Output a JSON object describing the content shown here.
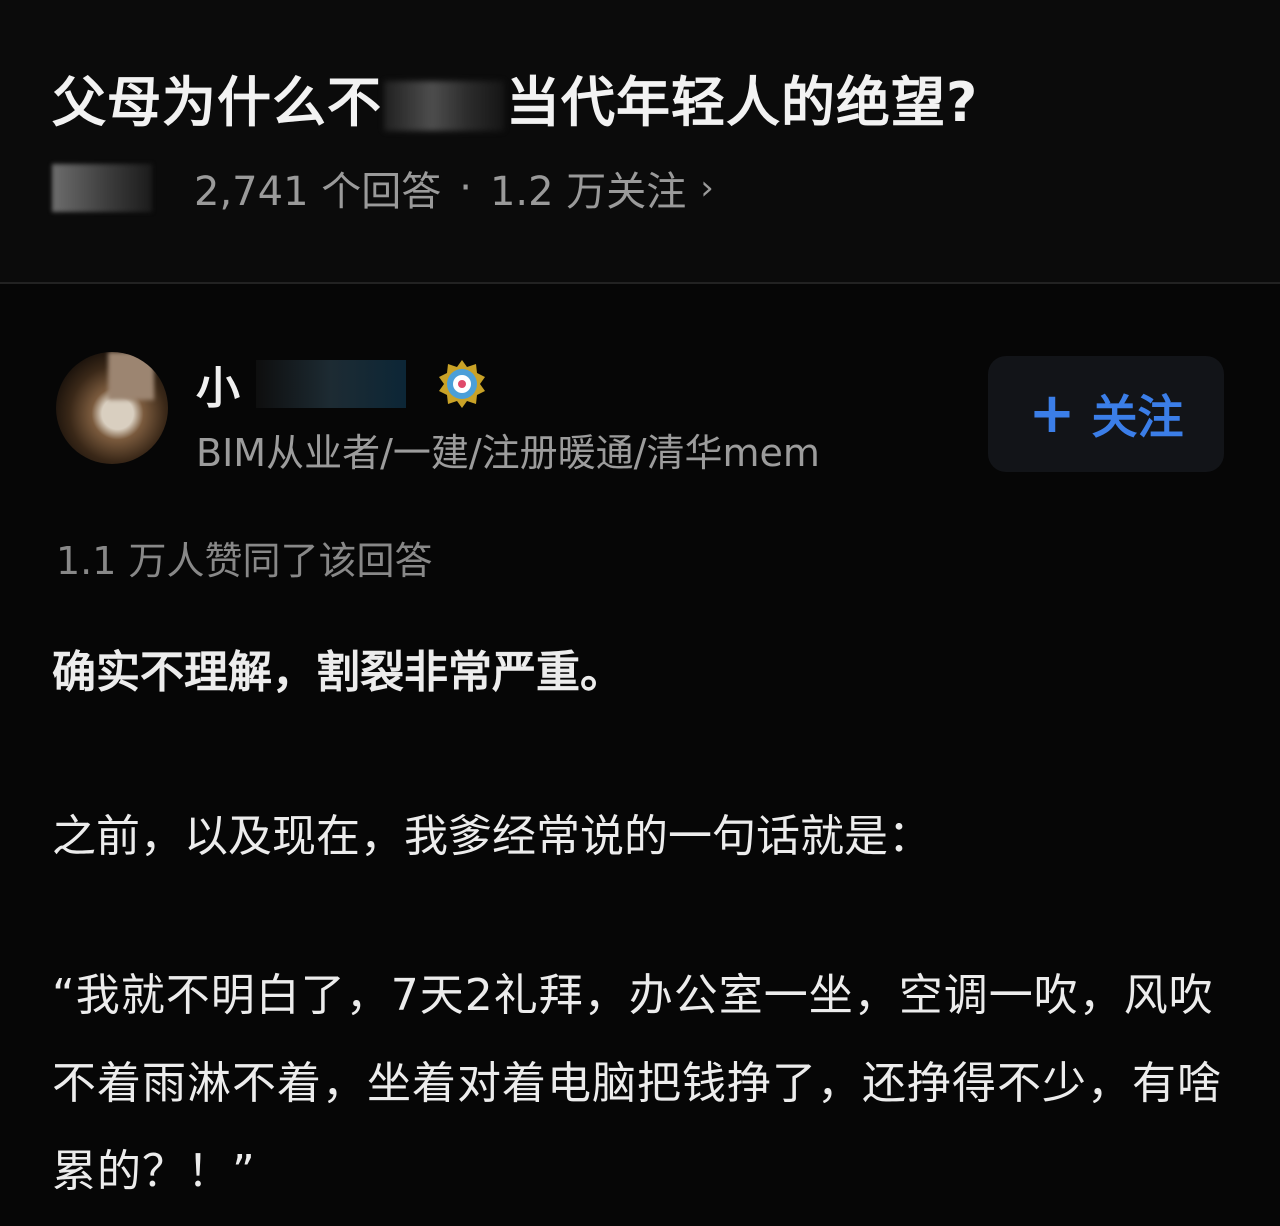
{
  "question": {
    "title_start": "父母为什么不",
    "title_end": "当代年轻人的绝望?",
    "answer_count": "2,741 个回答",
    "separator": "·",
    "follower_count": "1.2 万关注",
    "chevron": "›"
  },
  "answer": {
    "author": {
      "name_visible": "小",
      "bio": "BIM从业者/一建/注册暖通/清华mem",
      "badge_icon": "certified-badge-icon"
    },
    "follow_button": {
      "plus": "+",
      "label": "关注"
    },
    "upvote_text": "1.1 万人赞同了该回答",
    "paragraphs": [
      "确实不理解，割裂非常严重。",
      "之前，以及现在，我爹经常说的一句话就是：",
      "“我就不明白了，7天2礼拜，办公室一坐，空调一吹，风吹不着雨淋不着，坐着对着电脑把钱挣了，还挣得不少，有啥累的？！”"
    ]
  },
  "colors": {
    "background": "#060606",
    "accent_blue": "#3b7ee8",
    "secondary_text": "#9a9a9a"
  }
}
